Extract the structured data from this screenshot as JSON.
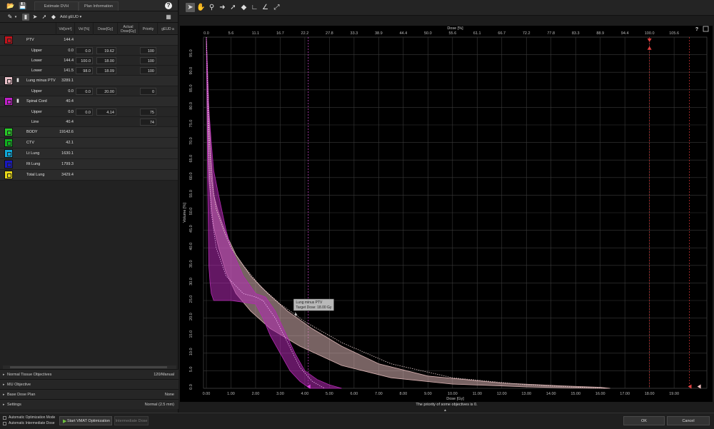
{
  "left_panel": {
    "tabs": {
      "estimate": "Estimate DVH",
      "plan_info": "Plan Information"
    },
    "toolbar": {
      "add_geud": "Add gEUD"
    },
    "columns": [
      "Vol[cm³]",
      "Vol [%]",
      "Dose[Gy]",
      "Actual Dose[Gy]",
      "Priority",
      "gEUD a"
    ],
    "structures": [
      {
        "name": "PTV",
        "volume": "144.4",
        "color": "#c0141c"
      },
      {
        "type": "objective",
        "name": "Upper",
        "vol_cm3": "0.0",
        "vol_pct": "0.0",
        "dose": "19.62",
        "priority": "100"
      },
      {
        "type": "objective",
        "name": "Lower",
        "vol_cm3": "144.4",
        "vol_pct": "100.0",
        "dose": "18.00",
        "priority": "100"
      },
      {
        "type": "objective",
        "name": "Lower",
        "vol_cm3": "141.5",
        "vol_pct": "98.0",
        "dose": "18.09",
        "priority": "100"
      },
      {
        "name": "Lung minus PTV",
        "volume": "3289.1",
        "color": "#e8c0c8"
      },
      {
        "type": "objective",
        "name": "Upper",
        "vol_cm3": "0.0",
        "vol_pct": "0.0",
        "dose": "20.00",
        "priority": "0"
      },
      {
        "name": "Spinal Cord",
        "volume": "40.4",
        "color": "#c020c8"
      },
      {
        "type": "objective",
        "name": "Upper",
        "vol_cm3": "0.0",
        "vol_pct": "0.0",
        "dose": "4.14",
        "priority": "75"
      },
      {
        "type": "objective",
        "name": "Line",
        "vol_cm3": "40.4",
        "vol_pct": "",
        "dose": "",
        "priority": "74"
      },
      {
        "name": "BODY",
        "volume": "19142.6",
        "color": "#28c828"
      },
      {
        "name": "CTV",
        "volume": "42.1",
        "color": "#10b020"
      },
      {
        "name": "Lt Lung",
        "volume": "1630.1",
        "color": "#10a8d8"
      },
      {
        "name": "Rt Lung",
        "volume": "1799.3",
        "color": "#1818c0"
      },
      {
        "name": "Total Lung",
        "volume": "3429.4",
        "color": "#e8d818"
      }
    ],
    "sections": [
      {
        "label": "Normal Tissue Objectives",
        "value": "120/Manual"
      },
      {
        "label": "MU Objective",
        "value": ""
      },
      {
        "label": "Base Dose Plan",
        "value": "None"
      },
      {
        "label": "Settings",
        "value": "Normal (2.5 mm)"
      }
    ]
  },
  "right_panel": {
    "help": "?",
    "status_message": "The priority of some objectives is 0.",
    "tooltip": {
      "line1": "Lung minus PTV",
      "line2": "Target Dose: 18.00 Gy"
    }
  },
  "chart_data": {
    "type": "line",
    "title": "",
    "top_axis_label": "Dose [%]",
    "xlabel": "Dose [Gy]",
    "ylabel": "Volume [%]",
    "xlim": [
      0,
      20
    ],
    "ylim": [
      0,
      100
    ],
    "x_ticks": [
      0,
      1,
      2,
      3,
      4,
      5,
      6,
      7,
      8,
      9,
      10,
      11,
      12,
      13,
      14,
      15,
      16,
      17,
      18,
      19
    ],
    "x_tick_labels": [
      "0.00",
      "1.00",
      "2.00",
      "3.00",
      "4.00",
      "5.00",
      "6.00",
      "7.00",
      "8.00",
      "9.00",
      "10.00",
      "11.00",
      "12.00",
      "13.00",
      "14.00",
      "15.00",
      "16.00",
      "17.00",
      "18.00",
      "19.00"
    ],
    "top_tick_labels": [
      "0.0",
      "5.6",
      "11.1",
      "16.7",
      "22.2",
      "27.8",
      "33.3",
      "38.9",
      "44.4",
      "50.0",
      "55.6",
      "61.1",
      "66.7",
      "72.2",
      "77.8",
      "83.3",
      "88.9",
      "94.4",
      "100.0",
      "105.6"
    ],
    "y_ticks": [
      0,
      5,
      10,
      15,
      20,
      25,
      30,
      35,
      40,
      45,
      50,
      55,
      60,
      65,
      70,
      75,
      80,
      85,
      90,
      95
    ],
    "y_tick_labels": [
      "0.0",
      "5.0",
      "10.0",
      "15.0",
      "20.0",
      "25.0",
      "30.0",
      "35.0",
      "40.0",
      "45.0",
      "50.0",
      "55.0",
      "60.0",
      "65.0",
      "70.0",
      "75.0",
      "80.0",
      "85.0",
      "90.0",
      "95.0"
    ],
    "grid": true,
    "bands": [
      {
        "name": "Lung minus PTV",
        "color": "#d9b2b2",
        "x_upper": [
          0.0,
          0.1,
          0.2,
          0.3,
          0.5,
          0.8,
          1.2,
          1.8,
          2.5,
          3.3,
          4.3,
          5.5,
          7.0,
          9.0,
          12.0,
          14.5,
          16.0,
          16.4
        ],
        "upper": [
          100,
          80,
          65,
          55,
          50,
          44,
          38,
          32,
          27,
          22,
          17,
          12,
          7,
          3.5,
          1.5,
          0.7,
          0.3,
          0
        ],
        "x_lower": [
          0.0,
          0.05,
          0.1,
          0.2,
          0.3,
          0.5,
          0.8,
          1.2,
          1.8,
          2.6,
          3.8,
          5.5,
          7.5,
          10.0,
          13.0,
          15.0,
          16.0
        ],
        "lower": [
          100,
          75,
          60,
          52,
          46,
          40,
          33,
          27,
          22,
          17,
          12,
          6.5,
          3,
          1.2,
          0.4,
          0.1,
          0
        ]
      },
      {
        "name": "Spinal Cord",
        "color": "#b42ab4",
        "x_upper": [
          0.0,
          0.05,
          0.1,
          0.2,
          0.3,
          0.5,
          0.8,
          1.0,
          1.5,
          2.0,
          2.4,
          2.8,
          3.2,
          3.6,
          4.0,
          4.5,
          5.0,
          5.5
        ],
        "upper": [
          100,
          90,
          80,
          70,
          62,
          55,
          45,
          40,
          32,
          27,
          26,
          22,
          16,
          10,
          5,
          2.5,
          1,
          0
        ],
        "x_lower": [
          0.0,
          0.03,
          0.05,
          0.08,
          0.1,
          0.15,
          0.2,
          0.3,
          0.5,
          1.0,
          2.0,
          2.3,
          2.6,
          3.0,
          3.4,
          3.8,
          4.2
        ],
        "lower": [
          100,
          80,
          60,
          45,
          35,
          30,
          27,
          25,
          25,
          25,
          24,
          20,
          15,
          10,
          5,
          2,
          0
        ]
      }
    ],
    "dotted_lines": [
      {
        "name": "Lung minus PTV",
        "color": "#e8d0d0",
        "x": [
          0.0,
          0.1,
          0.2,
          0.4,
          0.7,
          1.0,
          1.5,
          2.2,
          3.0,
          4.0,
          5.5,
          7.5,
          10.0,
          13.0,
          15.5,
          16.2
        ],
        "y": [
          100,
          75,
          60,
          51,
          45,
          40,
          35,
          29,
          24,
          19,
          13,
          7,
          3,
          1,
          0.2,
          0
        ]
      },
      {
        "name": "Spinal Cord",
        "color": "#f0b0f0",
        "x": [
          0.0,
          0.05,
          0.1,
          0.2,
          0.4,
          0.8,
          1.5,
          2.0,
          2.3,
          2.8,
          3.3,
          3.8,
          4.3,
          4.8
        ],
        "y": [
          100,
          85,
          65,
          50,
          40,
          32,
          27,
          26,
          25,
          20,
          13,
          6,
          2,
          0
        ]
      }
    ],
    "vertical_markers": [
      {
        "x": 4.14,
        "color": "#c040c0"
      },
      {
        "x": 18.0,
        "color": "#c03030"
      },
      {
        "x": 19.62,
        "color": "#c03030"
      }
    ],
    "objective_markers": [
      {
        "x": 18.0,
        "y": 99,
        "color": "#e04040",
        "dir": "down"
      },
      {
        "x": 18.0,
        "y": 97,
        "color": "#e04040",
        "dir": "up"
      },
      {
        "x": 19.62,
        "y": 0.5,
        "color": "#e04040",
        "dir": "left"
      },
      {
        "x": 20.0,
        "y": 0.5,
        "color": "#f0c0c0",
        "dir": "left"
      },
      {
        "x": 4.14,
        "y": 0.5,
        "color": "#e040e0",
        "dir": "left"
      }
    ]
  },
  "bottom_bar": {
    "auto_opt_mode": "Automatic Optimization Mode",
    "auto_int_dose": "Automatic Intermediate Dose",
    "start_vmat": "Start VMAT Optimization",
    "intermediate_dose": "Intermediate Dose",
    "ok": "OK",
    "cancel": "Cancel"
  }
}
